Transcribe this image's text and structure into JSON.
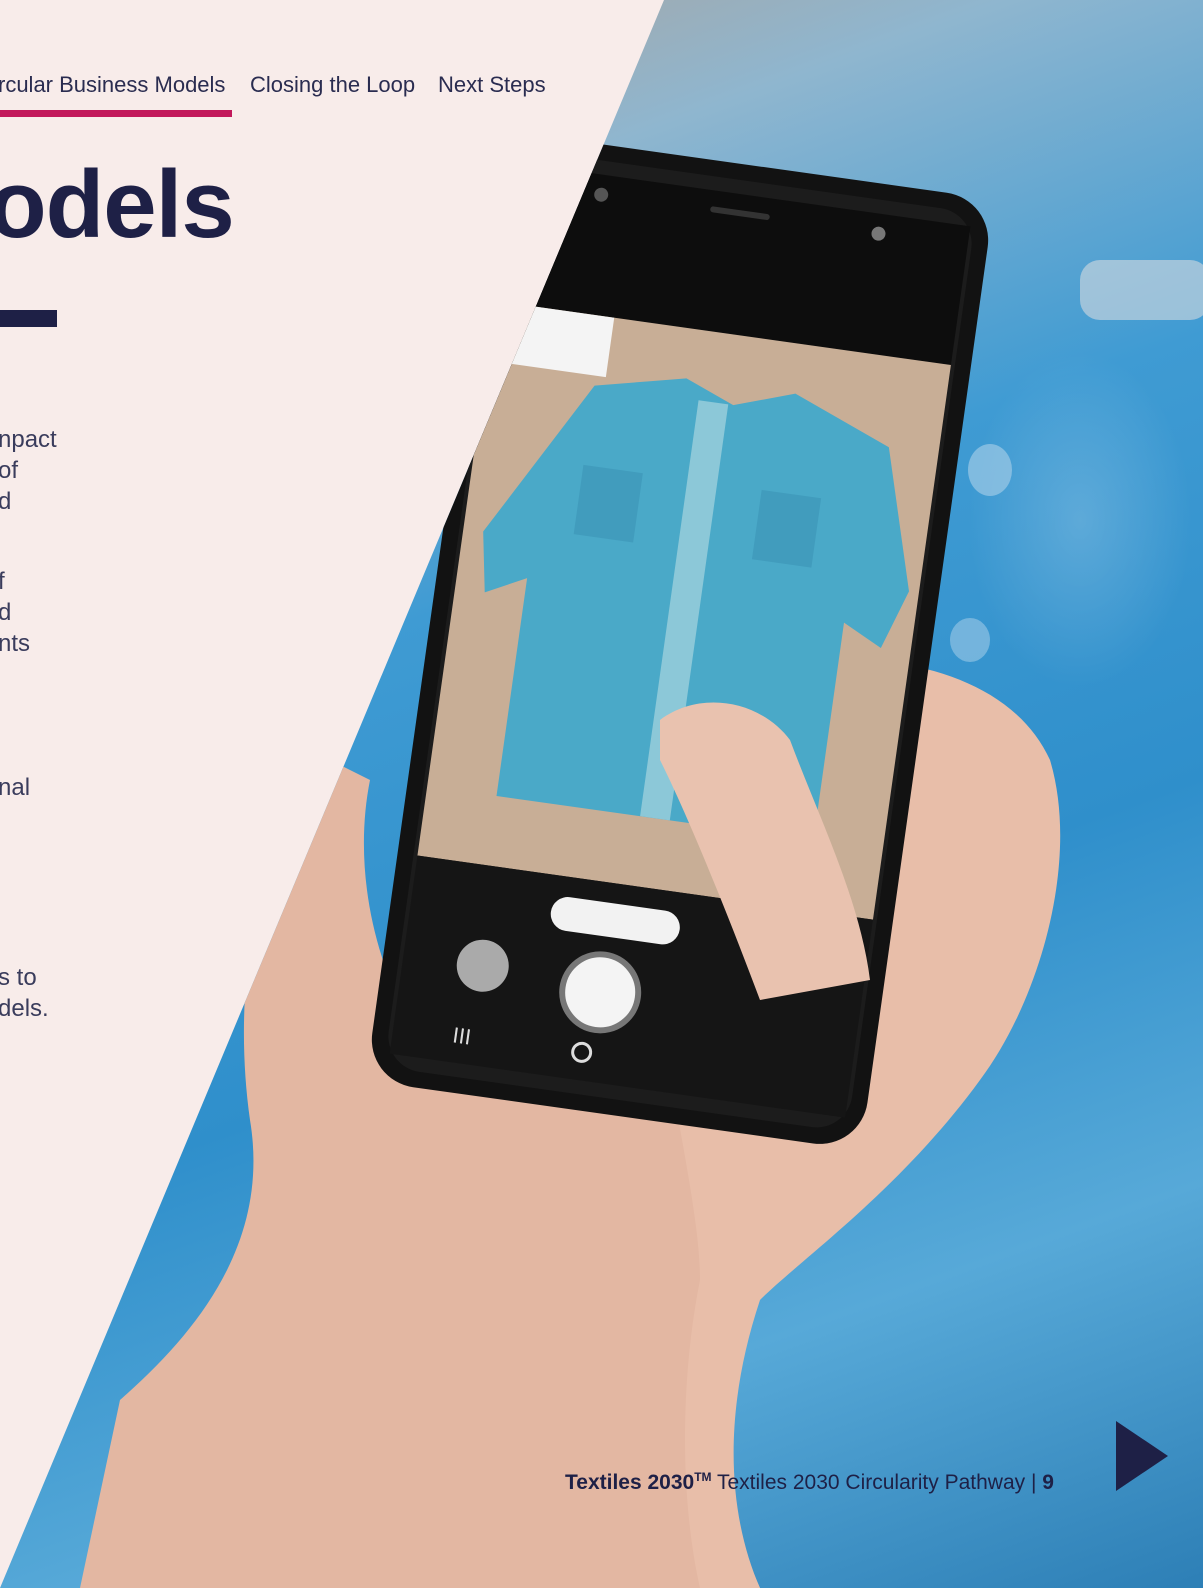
{
  "nav": {
    "items": [
      {
        "label": "rcular Business Models"
      },
      {
        "label": "Closing the Loop"
      },
      {
        "label": "Next Steps"
      }
    ]
  },
  "title": "odels",
  "body_fragments": [
    "npact",
    "of",
    "d",
    "f",
    "d",
    "nts",
    "nal",
    "s to",
    "dels."
  ],
  "footer": {
    "brand": "Textiles 2030",
    "trademark": "TM",
    "doc_title": "Textiles 2030 Circularity Pathway",
    "separator": "|",
    "page_number": "9"
  },
  "icons": {
    "next_page": "triangle-right-icon"
  },
  "colors": {
    "page_background": "#f8ecea",
    "navy": "#1e2046",
    "accent_magenta": "#c2185b",
    "denim_blue": "#3f9bd3"
  }
}
